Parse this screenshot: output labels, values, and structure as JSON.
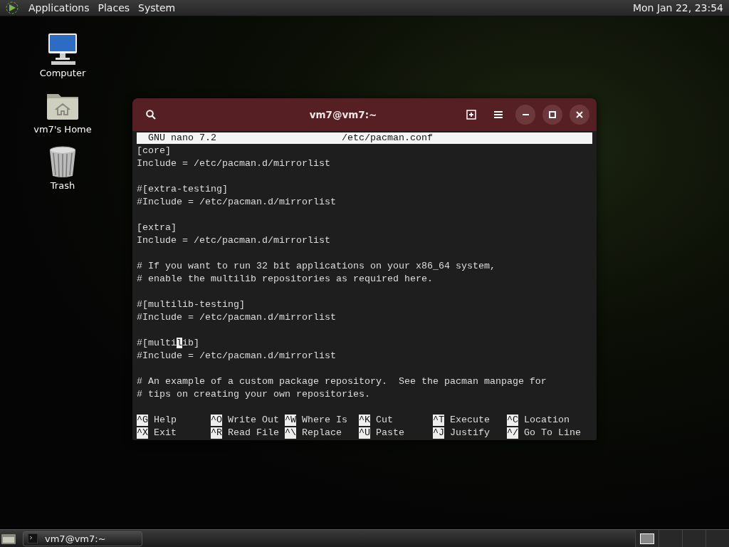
{
  "top_panel": {
    "menus": [
      "Applications",
      "Places",
      "System"
    ],
    "clock": "Mon Jan 22, 23:54"
  },
  "desktop_icons": [
    {
      "kind": "computer",
      "label": "Computer"
    },
    {
      "kind": "home",
      "label": "vm7's Home"
    },
    {
      "kind": "trash",
      "label": "Trash"
    }
  ],
  "window": {
    "title": "vm7@vm7:~",
    "nano": {
      "version": "GNU nano 7.2",
      "filename": "/etc/pacman.conf",
      "lines": [
        {
          "kind": "text",
          "text": "[core]"
        },
        {
          "kind": "text",
          "text": "Include = /etc/pacman.d/mirrorlist"
        },
        {
          "kind": "blank"
        },
        {
          "kind": "text",
          "text": "#[extra-testing]"
        },
        {
          "kind": "text",
          "text": "#Include = /etc/pacman.d/mirrorlist"
        },
        {
          "kind": "blank"
        },
        {
          "kind": "text",
          "text": "[extra]"
        },
        {
          "kind": "text",
          "text": "Include = /etc/pacman.d/mirrorlist"
        },
        {
          "kind": "blank"
        },
        {
          "kind": "text",
          "text": "# If you want to run 32 bit applications on your x86_64 system,"
        },
        {
          "kind": "text",
          "text": "# enable the multilib repositories as required here."
        },
        {
          "kind": "blank"
        },
        {
          "kind": "text",
          "text": "#[multilib-testing]"
        },
        {
          "kind": "text",
          "text": "#Include = /etc/pacman.d/mirrorlist"
        },
        {
          "kind": "blank"
        },
        {
          "kind": "cursor",
          "text": "#[multi",
          "cursor": "l",
          "after": "ib]"
        },
        {
          "kind": "text",
          "text": "#Include = /etc/pacman.d/mirrorlist"
        },
        {
          "kind": "blank"
        },
        {
          "kind": "text",
          "text": "# An example of a custom package repository.  See the pacman manpage for"
        },
        {
          "kind": "text",
          "text": "# tips on creating your own repositories."
        },
        {
          "kind": "blank"
        }
      ],
      "shortcuts": [
        [
          {
            "key": "^G",
            "label": "Help"
          },
          {
            "key": "^O",
            "label": "Write Out"
          },
          {
            "key": "^W",
            "label": "Where Is"
          },
          {
            "key": "^K",
            "label": "Cut"
          },
          {
            "key": "^T",
            "label": "Execute"
          },
          {
            "key": "^C",
            "label": "Location"
          }
        ],
        [
          {
            "key": "^X",
            "label": "Exit"
          },
          {
            "key": "^R",
            "label": "Read File"
          },
          {
            "key": "^\\",
            "label": "Replace"
          },
          {
            "key": "^U",
            "label": "Paste"
          },
          {
            "key": "^J",
            "label": "Justify"
          },
          {
            "key": "^/",
            "label": "Go To Line"
          }
        ]
      ]
    }
  },
  "taskbar": {
    "tasks": [
      {
        "label": "vm7@vm7:~",
        "selected": false
      }
    ]
  }
}
